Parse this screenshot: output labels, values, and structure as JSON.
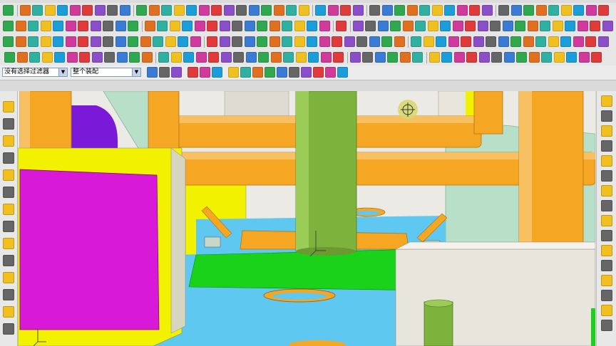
{
  "filter_bar": {
    "selection_filter": "没有选择过滤器",
    "scope_filter": "整个装配"
  },
  "toolbar_icon_colors": [
    "#3a7bd5",
    "#e03a3a",
    "#f0c020",
    "#2fa84f",
    "#8a4fc8",
    "#1a9dd9",
    "#e07020",
    "#666666",
    "#d03a9a",
    "#30b0a0"
  ],
  "viewport": {
    "colors": {
      "pipe": "#f5a623",
      "pipe_dark": "#c9801a",
      "column": "#7db33c",
      "column_dark": "#5a8a25",
      "magenta": "#d81ad8",
      "yellow": "#f2f200",
      "cyan": "#5ec8f0",
      "green_plate": "#1bd21b",
      "mint": "#b8e0c8",
      "gray_block": "#e8e6dc",
      "purple": "#7a1ad8"
    }
  }
}
